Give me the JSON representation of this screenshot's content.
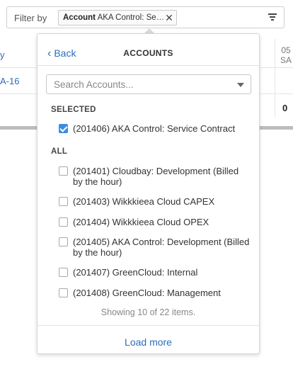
{
  "filter_bar": {
    "label": "Filter by",
    "chip": {
      "key": "Account",
      "value": "AKA Control: Se…",
      "remove_symbol": "✕"
    }
  },
  "background": {
    "left_partial_1": "y",
    "left_partial_2": "A-16",
    "day_number": "05",
    "day_abbr": "SA",
    "total_value": "0"
  },
  "dropdown": {
    "back_label": "Back",
    "back_chevron": "‹",
    "title": "ACCOUNTS",
    "search": {
      "placeholder": "Search Accounts...",
      "value": ""
    },
    "selected_heading": "SELECTED",
    "selected_items": [
      {
        "label": "(201406) AKA Control: Service Contract",
        "checked": true
      }
    ],
    "all_heading": "ALL",
    "all_items": [
      {
        "label": "(201401) Cloudbay: Development (Billed by the hour)",
        "checked": false
      },
      {
        "label": "(201403) Wikkkieea Cloud CAPEX",
        "checked": false
      },
      {
        "label": "(201404) Wikkkieea Cloud OPEX",
        "checked": false
      },
      {
        "label": "(201405) AKA Control: Development (Billed by the hour)",
        "checked": false
      },
      {
        "label": "(201407) GreenCloud: Internal",
        "checked": false
      },
      {
        "label": "(201408) GreenCloud: Management",
        "checked": false
      }
    ],
    "status_text": "Showing 10 of 22 items.",
    "load_more_label": "Load more"
  },
  "colors": {
    "link": "#2a6ebb",
    "checkbox_checked": "#3a8de0",
    "border": "#d5d5d5"
  }
}
